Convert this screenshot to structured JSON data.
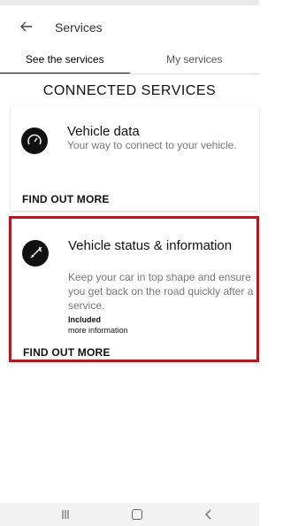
{
  "header": {
    "title": "Services"
  },
  "tabs": [
    {
      "label": "See the services",
      "active": true
    },
    {
      "label": "My services",
      "active": false
    }
  ],
  "section_title": "CONNECTED SERVICES",
  "cards": [
    {
      "title": "Vehicle data",
      "description": "Your way to connect to your vehicle.",
      "action": "FIND OUT MORE",
      "icon": "speedometer-icon"
    },
    {
      "title": "Vehicle status & information",
      "description": "Keep your car in top shape and ensure you get back on the road quickly after a service.",
      "status": "Included",
      "more_link": "more information",
      "action": "FIND OUT MORE",
      "icon": "wrench-icon",
      "highlighted": true
    }
  ],
  "colors": {
    "highlight_border": "#c0121c",
    "icon_bg": "#111111"
  }
}
